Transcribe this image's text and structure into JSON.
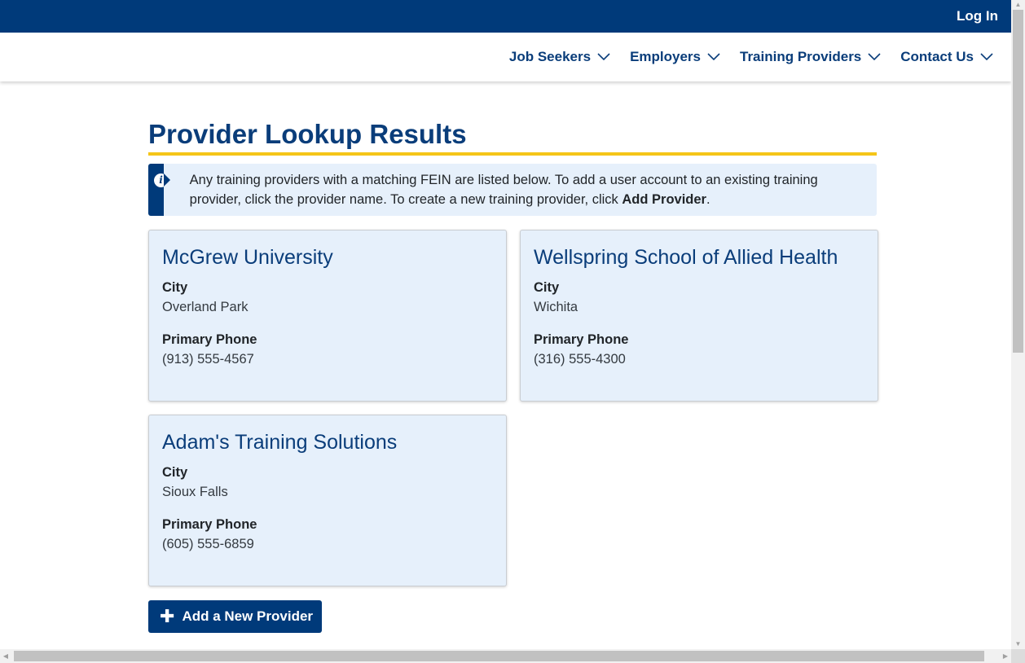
{
  "topbar": {
    "login_label": "Log In"
  },
  "nav": {
    "items": [
      {
        "label": "Job Seekers"
      },
      {
        "label": "Employers"
      },
      {
        "label": "Training Providers"
      },
      {
        "label": "Contact Us"
      }
    ]
  },
  "page": {
    "title": "Provider Lookup Results",
    "alert": {
      "text": "Any training providers with a matching FEIN are listed below. To add a user account to an existing training provider, click the provider name. To create a new training provider, click ",
      "bold": "Add Provider",
      "suffix": "."
    },
    "field_labels": {
      "city": "City",
      "phone": "Primary Phone"
    },
    "providers": [
      {
        "name": "McGrew University",
        "city": "Overland Park",
        "phone": "(913) 555-4567"
      },
      {
        "name": "Wellspring School of Allied Health",
        "city": "Wichita",
        "phone": "(316) 555-4300"
      },
      {
        "name": "Adam's Training Solutions",
        "city": "Sioux Falls",
        "phone": "(605) 555-6859"
      }
    ],
    "add_button": {
      "icon": "plus-icon",
      "label": "Add a New Provider"
    }
  },
  "colors": {
    "brand": "#003a7a",
    "accent": "#f5c518",
    "card_bg": "#e6f0fb"
  }
}
